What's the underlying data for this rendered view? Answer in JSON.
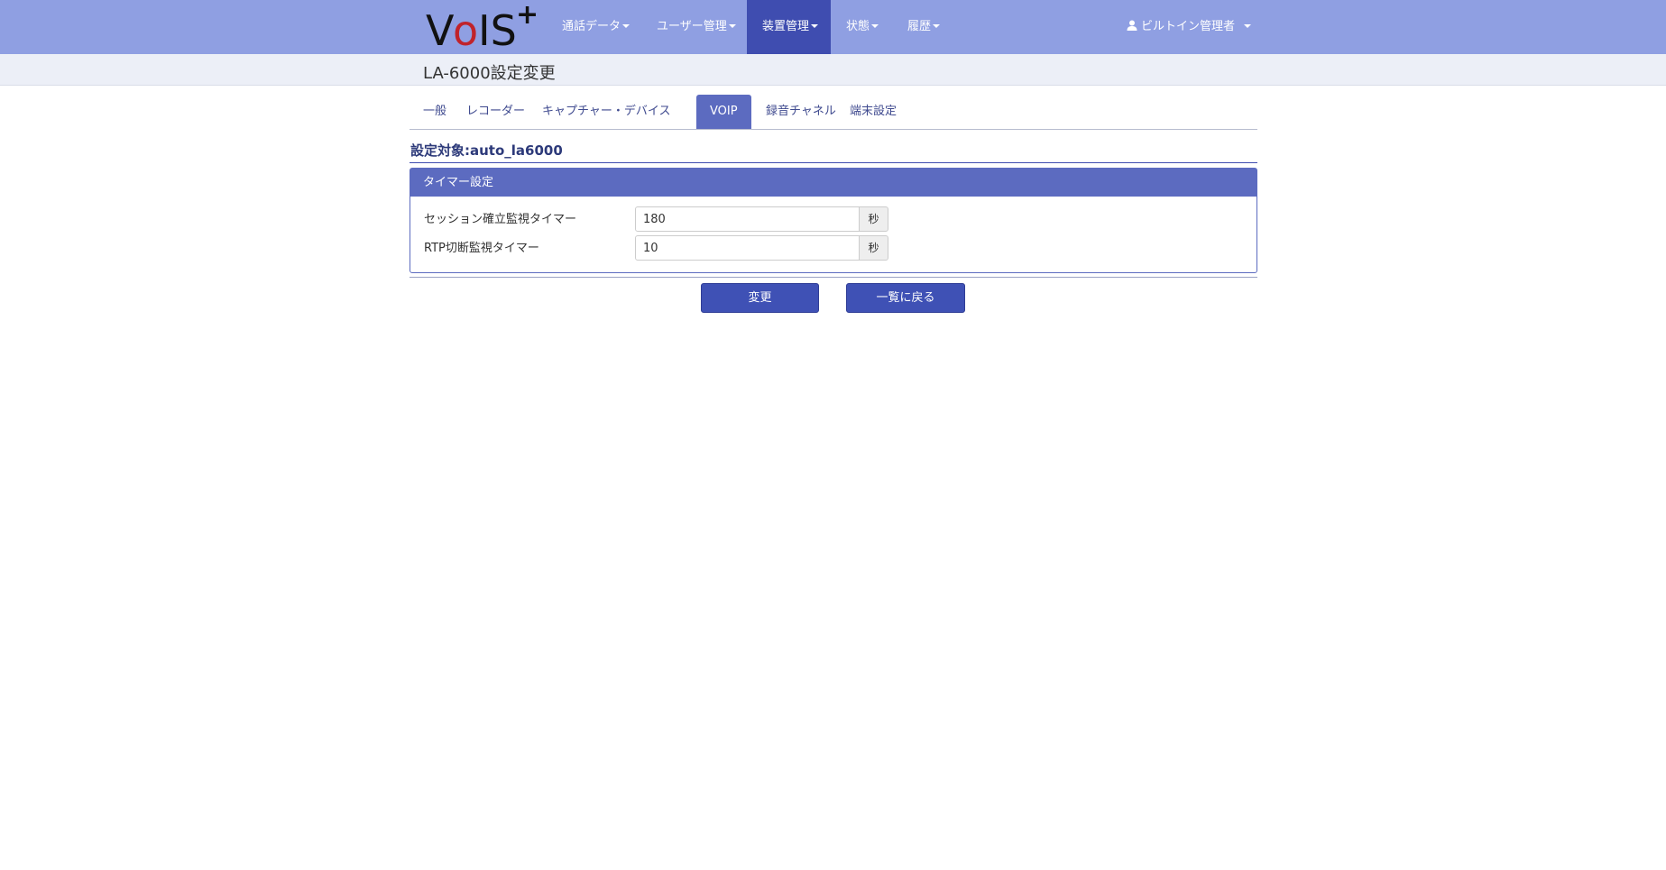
{
  "app": {
    "logo_text": "VoIS+",
    "colors": {
      "nav_bg": "#8f9fe2",
      "nav_active": "#3f4db0",
      "accent": "#5c6bc0",
      "button": "#3f51b5",
      "logo_red": "#c0232b"
    }
  },
  "nav": {
    "items": [
      {
        "label": "通話データ",
        "icon": "caret-down-icon"
      },
      {
        "label": "ユーザー管理",
        "icon": "caret-down-icon"
      },
      {
        "label": "装置管理",
        "icon": "caret-down-icon",
        "active": true
      },
      {
        "label": "状態",
        "icon": "caret-down-icon"
      },
      {
        "label": "履歴",
        "icon": "caret-down-icon"
      }
    ],
    "user": {
      "label": "ビルトイン管理者",
      "icon": "user-icon"
    }
  },
  "page": {
    "title": "LA-6000設定変更"
  },
  "tabs": [
    {
      "label": "一般"
    },
    {
      "label": "レコーダー"
    },
    {
      "label": "キャプチャー・デバイス"
    },
    {
      "label": "VOIP",
      "active": true
    },
    {
      "label": "録音チャネル"
    },
    {
      "label": "端末設定"
    }
  ],
  "target": {
    "label": "設定対象:auto_la6000"
  },
  "panel": {
    "heading": "タイマー設定",
    "rows": [
      {
        "label": "セッション確立監視タイマー",
        "value": "180",
        "unit": "秒"
      },
      {
        "label": "RTP切断監視タイマー",
        "value": "10",
        "unit": "秒"
      }
    ]
  },
  "buttons": {
    "submit": "変更",
    "back": "一覧に戻る"
  }
}
